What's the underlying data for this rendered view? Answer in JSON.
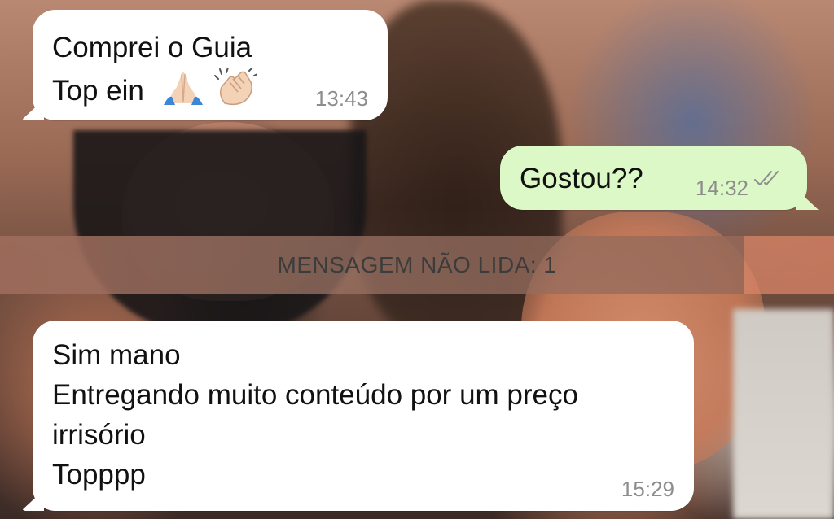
{
  "messages": [
    {
      "direction": "incoming",
      "lines": [
        "Comprei o Guia",
        "Top ein"
      ],
      "emojis": [
        "folded-hands-emoji",
        "clapping-hands-emoji"
      ],
      "time": "13:43"
    },
    {
      "direction": "outgoing",
      "lines": [
        "Gostou??"
      ],
      "time": "14:32",
      "status_icon": "double-check-icon"
    },
    {
      "direction": "incoming",
      "lines": [
        "Sim mano",
        "Entregando muito conteúdo por um preço",
        "irrisório",
        "Topppp"
      ],
      "time": "15:29"
    }
  ],
  "unread_banner": {
    "label": "MENSAGEM NÃO LIDA: 1"
  },
  "colors": {
    "incoming_bubble": "#ffffff",
    "outgoing_bubble": "#dcf8c6",
    "timestamp": "#8d8d8d",
    "ticks": "#8d8d8d"
  }
}
